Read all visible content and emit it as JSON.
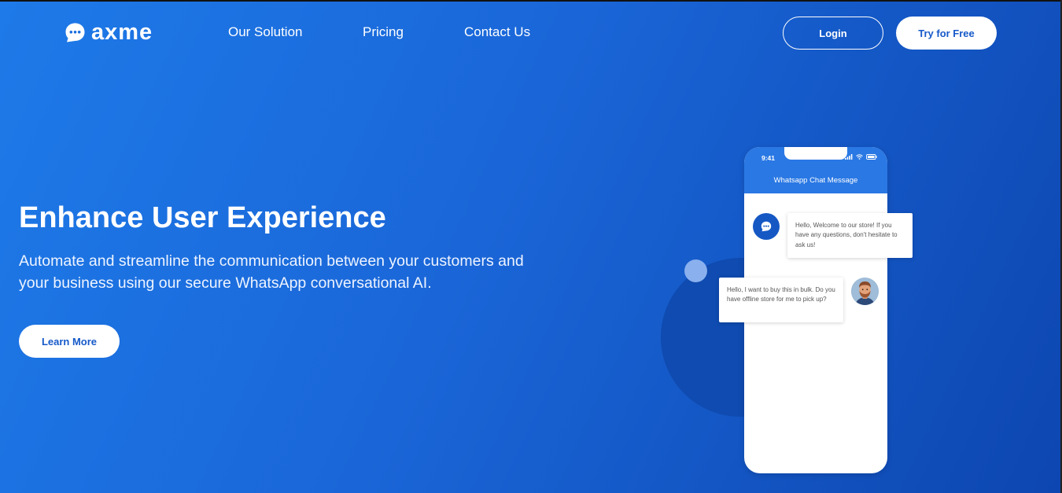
{
  "brand": {
    "name": "axme",
    "logo_icon": "chat-bubble-icon",
    "primary_color": "#1a66d8",
    "dark_color": "#0d46b0"
  },
  "nav": {
    "items": [
      {
        "label": "Our Solution"
      },
      {
        "label": "Pricing"
      },
      {
        "label": "Contact Us"
      }
    ]
  },
  "header_actions": {
    "login_label": "Login",
    "try_label": "Try for Free"
  },
  "hero": {
    "title": "Enhance User Experience",
    "subtitle": "Automate and streamline the communication between your customers and your business using our secure WhatsApp conversational AI.",
    "cta_label": "Learn More"
  },
  "phone": {
    "time": "9:41",
    "title": "Whatsapp Chat Message",
    "messages": [
      {
        "from": "bot",
        "text": "Hello, Welcome to our store! If you have any questions, don't hesitate to ask us!"
      },
      {
        "from": "user",
        "text": "Hello, I want to buy this in bulk. Do you have offline store for me to pick up?"
      }
    ]
  }
}
